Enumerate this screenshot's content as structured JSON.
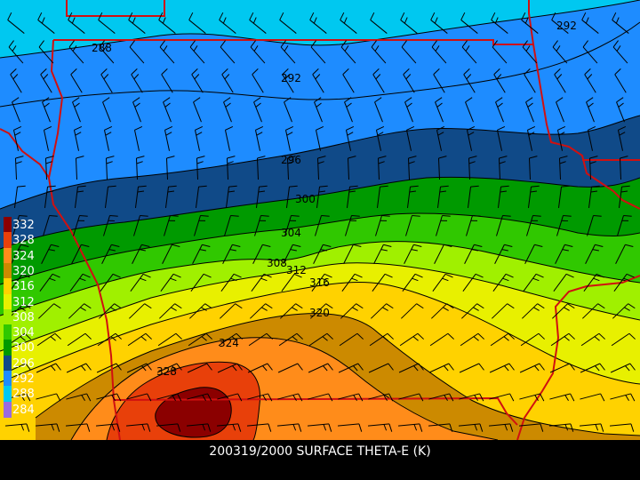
{
  "caption": "200319/2000 SURFACE THETA-E (K)",
  "legend": {
    "labels": [
      "332",
      "328",
      "324",
      "320",
      "316",
      "312",
      "308",
      "304",
      "300",
      "296",
      "292",
      "288",
      "284"
    ],
    "colors": [
      "#8b0000",
      "#e8400a",
      "#ff8c1a",
      "#cc8a00",
      "#ffd200",
      "#e8f000",
      "#a0f000",
      "#30c800",
      "#009a00",
      "#104a88",
      "#1e8cff",
      "#00c8f0",
      "#9a6adf"
    ]
  },
  "contour_labels": [
    {
      "text": "288"
    },
    {
      "text": "292"
    },
    {
      "text": "292"
    },
    {
      "text": "296"
    },
    {
      "text": "300"
    },
    {
      "text": "304"
    },
    {
      "text": "308"
    },
    {
      "text": "312"
    },
    {
      "text": "316"
    },
    {
      "text": "320"
    },
    {
      "text": "324"
    },
    {
      "text": "328"
    }
  ],
  "colors": {
    "state_border": "#d01010",
    "contour": "#000000",
    "barb": "#000000"
  }
}
